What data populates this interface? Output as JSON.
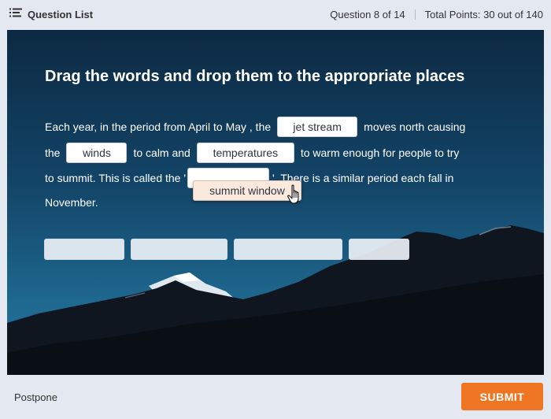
{
  "header": {
    "question_list_label": "Question List",
    "question_progress": "Question 8 of 14",
    "total_points": "Total Points: 30 out of 140"
  },
  "question": {
    "instruction": "Drag the words and drop them to the appropriate places",
    "line1_a": "Each year, in the period from April to May , the",
    "line1_b": "moves north causing",
    "line2_a": "the",
    "line2_b": "to calm and",
    "line2_c": "to warm enough for people to try",
    "line3_a": "to summit. This is called the '",
    "line3_b": "'. There is a similar period each fall in",
    "line4": "November.",
    "filled": {
      "slot1": "jet stream",
      "slot2": "winds",
      "slot3": "temperatures"
    },
    "dragging_word": "summit window"
  },
  "footer": {
    "postpone_label": "Postpone",
    "submit_label": "SUBMIT"
  },
  "colors": {
    "accent": "#ee7522",
    "chrome": "#e4e9f1",
    "dragging_chip": "#fbe9dd"
  },
  "icons": {
    "question_list": "list-icon",
    "cursor": "hand-cursor-icon"
  }
}
